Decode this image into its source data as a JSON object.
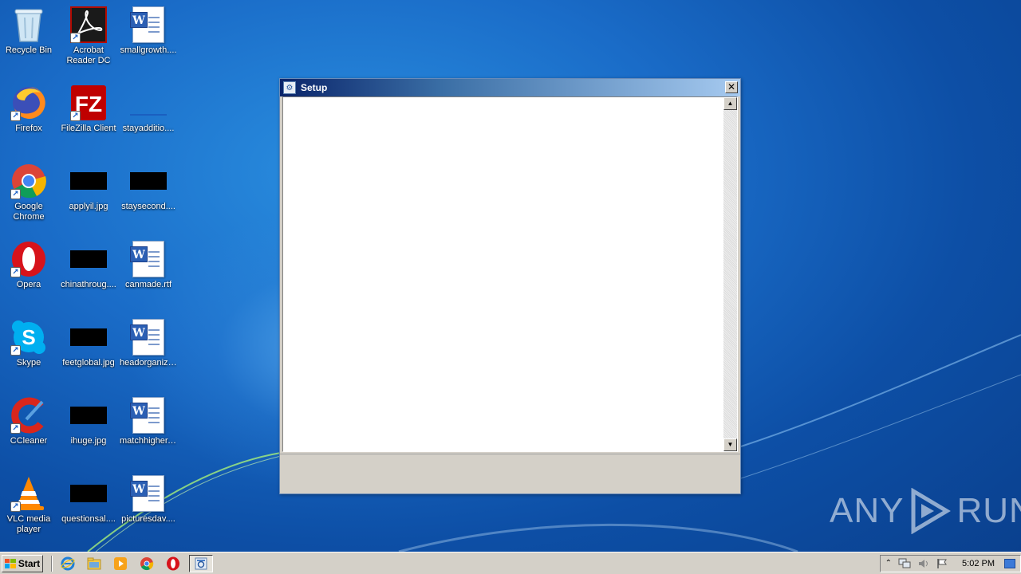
{
  "desktop": {
    "icons": [
      {
        "label": "Recycle Bin",
        "icon": "recycle-bin-icon"
      },
      {
        "label": "Acrobat Reader DC",
        "icon": "acrobat-icon"
      },
      {
        "label": "smallgrowth....",
        "icon": "word-doc-icon"
      },
      {
        "label": "Firefox",
        "icon": "firefox-icon"
      },
      {
        "label": "FileZilla Client",
        "icon": "filezilla-icon"
      },
      {
        "label": "stayadditio....",
        "icon": "blank-file-icon"
      },
      {
        "label": "Google Chrome",
        "icon": "chrome-icon"
      },
      {
        "label": "applyil.jpg",
        "icon": "image-thumb-icon"
      },
      {
        "label": "staysecond....",
        "icon": "image-thumb-icon"
      },
      {
        "label": "Opera",
        "icon": "opera-icon"
      },
      {
        "label": "chinathroug....",
        "icon": "image-thumb-icon"
      },
      {
        "label": "canmade.rtf",
        "icon": "word-doc-icon"
      },
      {
        "label": "Skype",
        "icon": "skype-icon"
      },
      {
        "label": "feetglobal.jpg",
        "icon": "image-thumb-icon"
      },
      {
        "label": "headorganiz....",
        "icon": "word-doc-icon"
      },
      {
        "label": "CCleaner",
        "icon": "ccleaner-icon"
      },
      {
        "label": "ihuge.jpg",
        "icon": "image-thumb-icon"
      },
      {
        "label": "matchhigher....",
        "icon": "word-doc-icon"
      },
      {
        "label": "VLC media player",
        "icon": "vlc-icon"
      },
      {
        "label": "questionsal....",
        "icon": "image-thumb-icon"
      },
      {
        "label": "picturesdav....",
        "icon": "word-doc-icon"
      }
    ]
  },
  "setup_window": {
    "title": "Setup",
    "close_glyph": "✕"
  },
  "watermark": {
    "left": "ANY",
    "right": "RUN"
  },
  "taskbar": {
    "start_label": "Start",
    "pinned": [
      "internet-explorer-icon",
      "file-explorer-icon",
      "media-player-icon",
      "chrome-icon",
      "opera-icon"
    ],
    "active_task": "setup-task-icon",
    "clock": "5:02 PM"
  }
}
